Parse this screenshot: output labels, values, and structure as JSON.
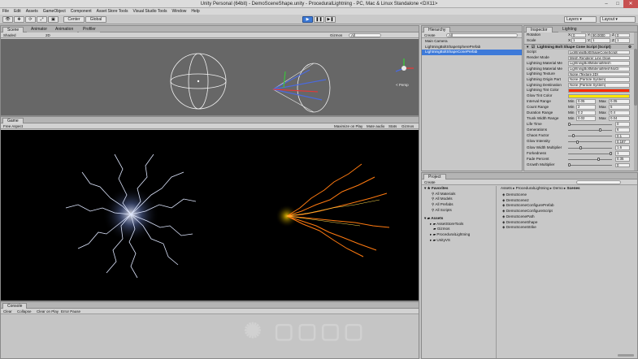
{
  "window": {
    "title": "Unity Personal (64bit) - DemoSceneShape.unity - ProceduralLightning - PC, Mac & Linux Standalone <DX11>"
  },
  "menu": [
    "File",
    "Edit",
    "Assets",
    "GameObject",
    "Component",
    "Asset Store Tools",
    "Visual Studio Tools",
    "Window",
    "Help"
  ],
  "toolbar": {
    "center_label": "Center",
    "global_label": "Global",
    "layers_label": "Layers",
    "layout_label": "Layout"
  },
  "scene": {
    "tab_scene": "Scene",
    "tab_animator": "Animator",
    "tab_animation": "Animation",
    "tab_profiler": "Profiler",
    "shaded": "Shaded",
    "mode_2d": "2D",
    "gizmos": "Gizmos",
    "search_placeholder": "All",
    "persp": "< Persp"
  },
  "game": {
    "tab_game": "Game",
    "aspect": "Free Aspect",
    "maximize": "Maximize on Play",
    "mute": "Mute audio",
    "stats": "Stats",
    "gizmos": "Gizmos"
  },
  "console": {
    "tab": "Console",
    "clear": "Clear",
    "collapse": "Collapse",
    "clear_on_play": "Clear on Play",
    "error_pause": "Error Pause"
  },
  "hierarchy": {
    "tab": "Hierarchy",
    "create": "Create",
    "search_placeholder": "All",
    "items": [
      "Main Camera",
      "LightningBoltShapeSpherePrefab",
      "LightningBoltShapeConePrefab"
    ]
  },
  "inspector": {
    "tab_inspector": "Inspector",
    "tab_lighting": "Lighting",
    "rotation_label": "Rotation",
    "rotation": {
      "x": "0",
      "y": "90.0000",
      "z": "0"
    },
    "scale_label": "Scale",
    "scale": {
      "x": "1",
      "y": "1",
      "z": "1"
    },
    "component_title": "Lightning Bolt Shape Cone Script (Script)",
    "script_label": "Script",
    "script_value": "LightningBoltShapeConeScript",
    "rows": [
      {
        "label": "Render Mode",
        "value": "Mesh Renderer Line Glow"
      },
      {
        "label": "Lightning Material Me",
        "value": "LightningBoltMaterialMesh"
      },
      {
        "label": "Lightning Material Me",
        "value": "LightningBoltMaterialMeshNoGl"
      },
      {
        "label": "Lightning Texture",
        "value": "None (Texture 2D)"
      },
      {
        "label": "Lightning Origin Part",
        "value": "None (Particle System)"
      },
      {
        "label": "Lightning Destination",
        "value": "None (Particle System)"
      }
    ],
    "tint_label": "Lightning Tint Color",
    "glow_tint_label": "Glow Tint Color",
    "tint_color": "#ff2a00",
    "glow_tint_color": "#ffe600",
    "ranges": [
      {
        "label": "Interval Range",
        "min_label": "Min",
        "min": "0.05",
        "max_label": "Max",
        "max": "0.05"
      },
      {
        "label": "Count Range",
        "min_label": "Min",
        "min": "2",
        "max_label": "Max",
        "max": "5"
      },
      {
        "label": "Duration Range",
        "min_label": "Min",
        "min": "0.2",
        "max_label": "Max",
        "max": "0.4"
      },
      {
        "label": "Trunk Width Range",
        "min_label": "Min",
        "min": "0.02",
        "max_label": "Max",
        "max": "0.04"
      }
    ],
    "sliders": [
      {
        "label": "Life Time",
        "value": "0",
        "level": 0.0
      },
      {
        "label": "Generations",
        "value": "6",
        "level": 0.75
      },
      {
        "label": "Chaos Factor",
        "value": "0.1",
        "level": 0.1
      },
      {
        "label": "Glow Intensity",
        "value": "0.187",
        "level": 0.187
      },
      {
        "label": "Glow Width Multiplier",
        "value": "1.6",
        "level": 0.27
      },
      {
        "label": "Forkedness",
        "value": "1",
        "level": 1.0
      },
      {
        "label": "Fade Percent",
        "value": "0.35",
        "level": 0.7
      },
      {
        "label": "Growth Multiplier",
        "value": "0",
        "level": 0.0
      }
    ]
  },
  "project": {
    "tab": "Project",
    "create": "Create",
    "favorites_label": "Favorites",
    "favorites": [
      "All Materials",
      "All Models",
      "All Prefabs",
      "All Scripts"
    ],
    "assets_label": "Assets",
    "asset_folders": [
      "AssetStoreTools",
      "Gizmos",
      "ProceduralLightning",
      "UnityVS"
    ],
    "breadcrumb": [
      "Assets",
      "ProceduralLightning",
      "Demo",
      "Scenes"
    ],
    "files": [
      "DemoScene",
      "DemoScene2",
      "DemoSceneConfigurePrefab",
      "DemoSceneConfigureScript",
      "DemoScenePath",
      "DemoSceneShape",
      "DemoSceneStrike"
    ]
  },
  "colors": {
    "accent": "#3c79d6",
    "selection": "#3e7ad9"
  }
}
